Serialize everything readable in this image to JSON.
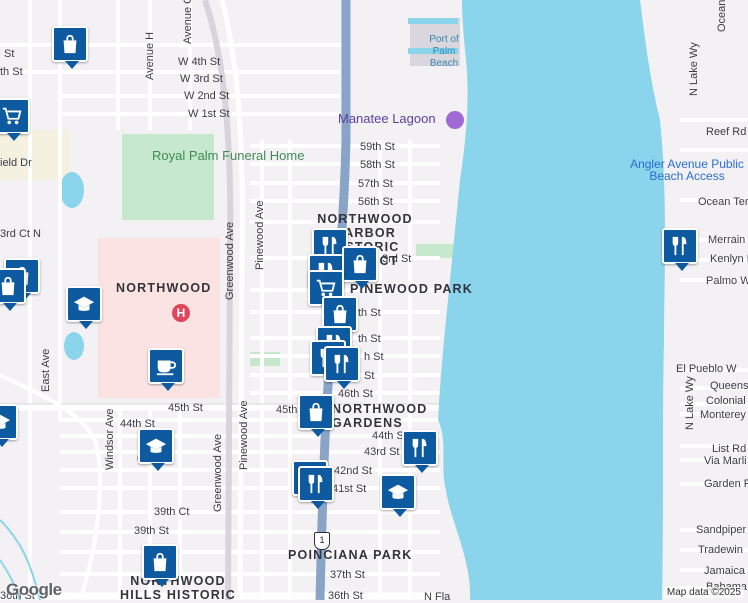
{
  "map": {
    "water_color": "#8ad4ec",
    "park_color": "#c6e8cd",
    "hospital_area_color": "#fbe3e3",
    "road_color": "#ffffff",
    "highway_color": "#8aa4c8",
    "pin_color": "#0d5aa0",
    "places": {
      "port": "Port of Palm Beach",
      "manatee": "Manatee Lagoon",
      "royal_palm": "Royal Palm Funeral Home",
      "angler": "Angler Avenue Public Beach Access",
      "northwood_harbor": "NORTHWOOD HARBOR HISTORIC DISTRICT",
      "northwood": "NORTHWOOD",
      "pinewood_park": "PINEWOOD PARK",
      "northwood_gardens": "NORTHWOOD GARDENS",
      "poinciana_park": "POINCIANA PARK",
      "northwood_hills": "NORTHWOOD HILLS HISTORIC"
    },
    "streets": {
      "w4th": "W 4th St",
      "w3rd": "W 3rd St",
      "w2nd": "W 2nd St",
      "w1st": "W 1st St",
      "s59": "59th St",
      "s58": "58th St",
      "s57": "57th St",
      "s56": "56th St",
      "s53rd": "3rd St",
      "s_th": "th St",
      "s_th2": "th St",
      "s_h": "h St",
      "s_st": "St",
      "s46": "46th St",
      "s45": "45th St",
      "s45b": "45th St",
      "s44": "44th St",
      "s44b": "44th St",
      "s43": "43rd St",
      "s42": "42nd St",
      "s41": "41st St",
      "s39": "39th St",
      "s39ct": "39th Ct",
      "s37": "37th St",
      "s36": "36th St",
      "s36b": "36th St",
      "ave_h": "Avenue H",
      "ave_g": "Avenue G",
      "greenwood": "Greenwood Ave",
      "greenwood2": "Greenwood Ave",
      "pinewood": "Pinewood Ave",
      "pinewood2": "Pinewood Ave",
      "east": "East Ave",
      "windsor": "Windsor Ave",
      "field": "ield Dr",
      "ct53": "3rd Ct N",
      "sixth": "th St",
      "eighth": "th St",
      "fifth": "St",
      "ocean_blvd": "Ocean Blvd",
      "n_lake_wy": "N Lake Wy",
      "n_lake_wy2": "N Lake Wy",
      "reef": "Reef Rd",
      "ocean_ter": "Ocean Ter",
      "merrain": "Merrain",
      "kenlyn": "Kenlyn R",
      "palmo": "Palmo W",
      "el_pueblo": "El Pueblo W",
      "queens": "Queens",
      "colonial": "Colonial",
      "monterey": "Monterey",
      "list": "List Rd",
      "via_marli": "Via Marli",
      "garden": "Garden R",
      "sandpiper": "Sandpiper",
      "tradewind": "Tradewin",
      "jamaica": "Jamaica",
      "bahama": "Bahama",
      "n_fla": "N Fla",
      "route_1": "1",
      "s45ws": "S"
    },
    "pins": [
      {
        "name": "shopping-bag",
        "type": "bag"
      },
      {
        "name": "grocery-cart",
        "type": "cart"
      },
      {
        "name": "shopping-bag",
        "type": "bag"
      },
      {
        "name": "shopping-bag",
        "type": "bag"
      },
      {
        "name": "school",
        "type": "school"
      },
      {
        "name": "cafe",
        "type": "cafe"
      },
      {
        "name": "school",
        "type": "school"
      },
      {
        "name": "shopping-bag",
        "type": "bag"
      },
      {
        "name": "restaurant",
        "type": "food"
      },
      {
        "name": "restaurant",
        "type": "food"
      },
      {
        "name": "shopping-bag",
        "type": "bag"
      },
      {
        "name": "grocery-cart",
        "type": "cart"
      },
      {
        "name": "shopping-bag",
        "type": "bag"
      },
      {
        "name": "restaurant",
        "type": "food"
      },
      {
        "name": "restaurant",
        "type": "food"
      },
      {
        "name": "restaurant",
        "type": "food"
      },
      {
        "name": "shopping-bag",
        "type": "bag"
      },
      {
        "name": "restaurant",
        "type": "food"
      },
      {
        "name": "restaurant",
        "type": "food"
      },
      {
        "name": "school",
        "type": "school"
      },
      {
        "name": "restaurant",
        "type": "food"
      }
    ],
    "hospital_symbol": "H",
    "route_shield": "1"
  },
  "footer": {
    "logo": "Google",
    "attribution": "Map data ©2025"
  }
}
